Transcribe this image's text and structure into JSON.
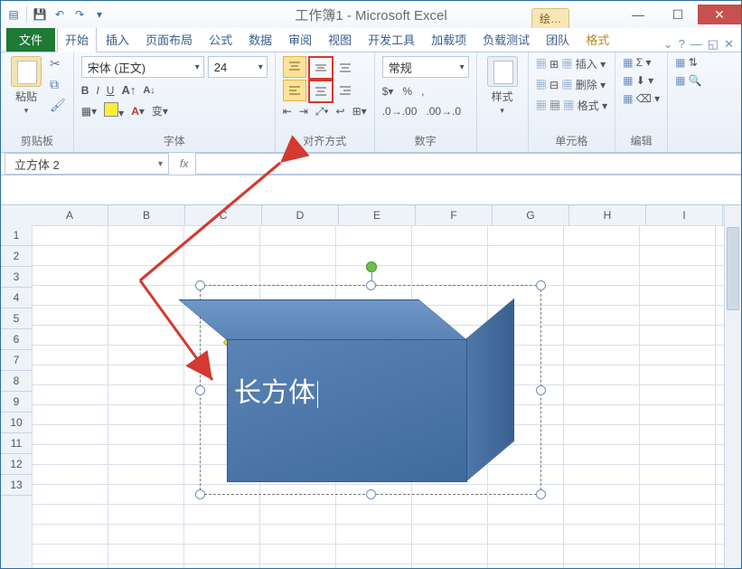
{
  "title": "工作簿1 - Microsoft Excel",
  "contextual_tab": "绘…",
  "window_buttons": {
    "min": "—",
    "max": "☐",
    "close": "✕"
  },
  "tabs": {
    "file": "文件",
    "home": "开始",
    "insert": "插入",
    "layout": "页面布局",
    "formulas": "公式",
    "data": "数据",
    "review": "审阅",
    "view": "视图",
    "developer": "开发工具",
    "addins": "加载项",
    "loadtest": "负载测试",
    "team": "团队",
    "format": "格式"
  },
  "ribbon": {
    "clipboard": {
      "label": "剪贴板",
      "paste": "粘贴"
    },
    "font": {
      "label": "字体",
      "name": "宋体 (正文)",
      "size": "24"
    },
    "alignment": {
      "label": "对齐方式"
    },
    "number": {
      "label": "数字",
      "format": "常规"
    },
    "styles": {
      "label": "样式",
      "btn": "样式"
    },
    "cells": {
      "label": "单元格",
      "insert": "插入",
      "delete": "删除",
      "format": "格式"
    },
    "editing": {
      "label": "编辑"
    }
  },
  "namebox": "立方体 2",
  "columns": [
    "A",
    "B",
    "C",
    "D",
    "E",
    "F",
    "G",
    "H",
    "I"
  ],
  "rows": [
    "1",
    "2",
    "3",
    "4",
    "5",
    "6",
    "7",
    "8",
    "9",
    "10",
    "11",
    "12",
    "13"
  ],
  "shape_text": "长方体"
}
